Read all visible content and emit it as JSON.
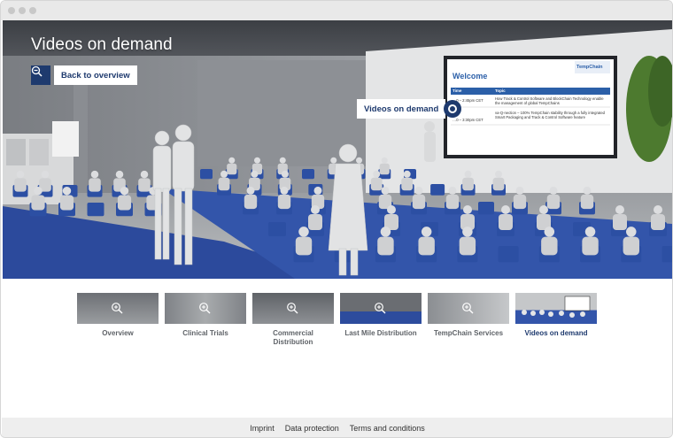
{
  "hero": {
    "title": "Videos on demand",
    "back_label": "Back to overview",
    "hotspot_label": "Videos on demand"
  },
  "screen": {
    "title": "Welcome",
    "brand": "TempChain",
    "col_time": "Time",
    "col_topic": "Topic",
    "rows": [
      {
        "time": "…0 – 2:45pm CET",
        "topic": "How Track & Control Software and BlockChain Technology enable the management of global TempChains"
      },
      {
        "time": "…0 – 3:30pm CET",
        "topic": "va-Q-nection – 100% TempChain stability through a fully integrated Smart Packaging and Track & Control Software feature"
      }
    ]
  },
  "thumbnails": [
    {
      "label": "Overview",
      "active": false
    },
    {
      "label": "Clinical Trials",
      "active": false
    },
    {
      "label": "Commercial Distribution",
      "active": false
    },
    {
      "label": "Last Mile Distribution",
      "active": false
    },
    {
      "label": "TempChain Services",
      "active": false
    },
    {
      "label": "Videos on demand",
      "active": true
    }
  ],
  "footer": {
    "links": [
      "Imprint",
      "Data protection",
      "Terms and conditions"
    ]
  },
  "colors": {
    "accent": "#1e3a6e",
    "text_muted": "#5f6368",
    "footer_bg": "#eeeeee",
    "chair_blue": "#2c4fa3"
  }
}
